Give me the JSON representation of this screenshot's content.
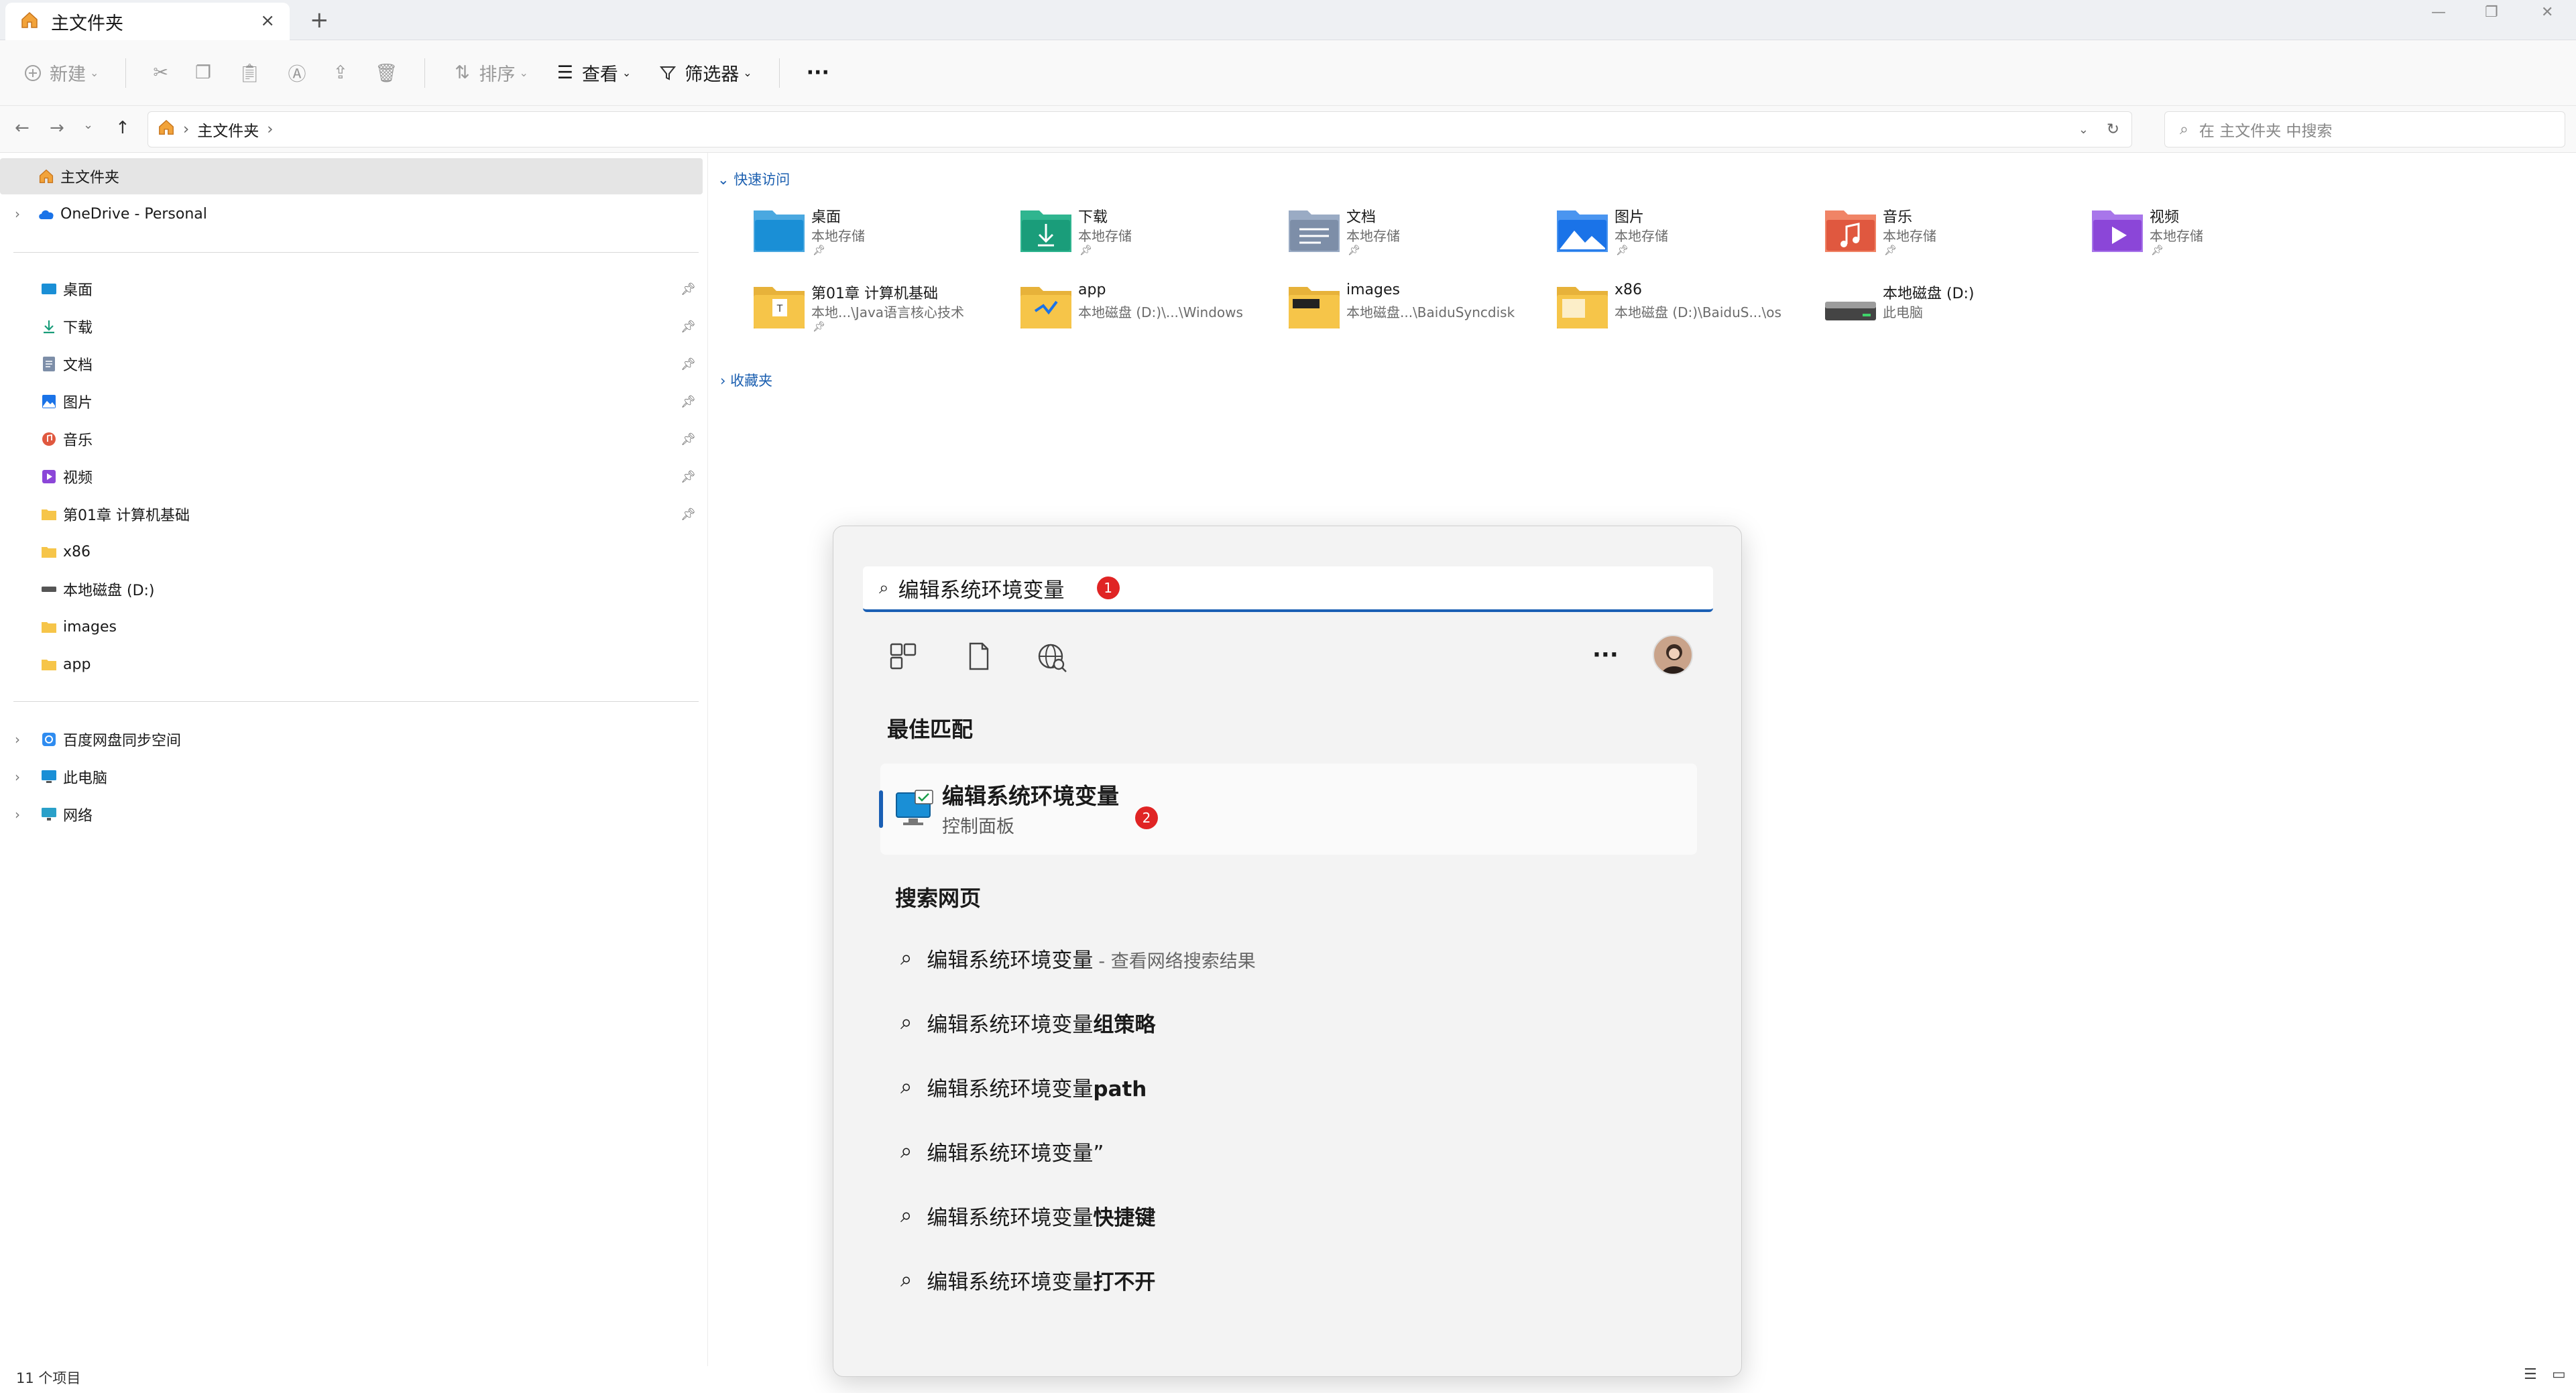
{
  "window": {
    "tab_title": "主文件夹",
    "tab_close": "×",
    "new_tab": "+"
  },
  "toolbar": {
    "new_label": "新建",
    "sort_label": "排序",
    "view_label": "查看",
    "filter_label": "筛选器",
    "more_label": "···"
  },
  "address": {
    "crumb": "主文件夹",
    "search_placeholder": "在 主文件夹 中搜索"
  },
  "sidebar": {
    "home": "主文件夹",
    "onedrive": "OneDrive - Personal",
    "pinned": [
      {
        "label": "桌面"
      },
      {
        "label": "下载"
      },
      {
        "label": "文档"
      },
      {
        "label": "图片"
      },
      {
        "label": "音乐"
      },
      {
        "label": "视频"
      },
      {
        "label": "第01章 计算机基础"
      },
      {
        "label": "x86"
      },
      {
        "label": "本地磁盘 (D:)"
      },
      {
        "label": "images"
      },
      {
        "label": "app"
      }
    ],
    "bottom": [
      {
        "label": "百度网盘同步空间"
      },
      {
        "label": "此电脑"
      },
      {
        "label": "网络"
      }
    ]
  },
  "main": {
    "quick_access_label": "快速访问",
    "favorites_label": "收藏夹",
    "quick_access": [
      {
        "name": "桌面",
        "sub": "本地存储",
        "icon": "desktop-folder"
      },
      {
        "name": "下载",
        "sub": "本地存储",
        "icon": "download-folder"
      },
      {
        "name": "文档",
        "sub": "本地存储",
        "icon": "documents-folder"
      },
      {
        "name": "图片",
        "sub": "本地存储",
        "icon": "pictures-folder"
      },
      {
        "name": "音乐",
        "sub": "本地存储",
        "icon": "music-folder"
      },
      {
        "name": "视频",
        "sub": "本地存储",
        "icon": "videos-folder"
      },
      {
        "name": "第01章 计算机基础",
        "sub": "本地...\\Java语言核心技术",
        "icon": "folder"
      },
      {
        "name": "app",
        "sub": "本地磁盘 (D:)\\...\\Windows",
        "icon": "folder"
      },
      {
        "name": "images",
        "sub": "本地磁盘...\\BaiduSyncdisk",
        "icon": "folder"
      },
      {
        "name": "x86",
        "sub": "本地磁盘 (D:)\\BaiduS...\\os",
        "icon": "folder"
      },
      {
        "name": "本地磁盘 (D:)",
        "sub": "此电脑",
        "icon": "drive"
      }
    ]
  },
  "status": {
    "count": "11 个项目"
  },
  "flyout": {
    "query": "编辑系统环境变量",
    "badge1": "1",
    "badge2": "2",
    "best_match_heading": "最佳匹配",
    "best_match_title": "编辑系统环境变量",
    "best_match_sub": "控制面板",
    "web_heading": "搜索网页",
    "web_results": [
      {
        "base": "编辑系统环境变量",
        "bold": "",
        "hint": "- 查看网络搜索结果"
      },
      {
        "base": "编辑系统环境变量",
        "bold": "组策略",
        "hint": ""
      },
      {
        "base": "编辑系统环境变量",
        "bold": "path",
        "hint": ""
      },
      {
        "base": "编辑系统环境变量”",
        "bold": "",
        "hint": ""
      },
      {
        "base": "编辑系统环境变量",
        "bold": "快捷键",
        "hint": ""
      },
      {
        "base": "编辑系统环境变量",
        "bold": "打不开",
        "hint": ""
      }
    ],
    "more": "···"
  }
}
